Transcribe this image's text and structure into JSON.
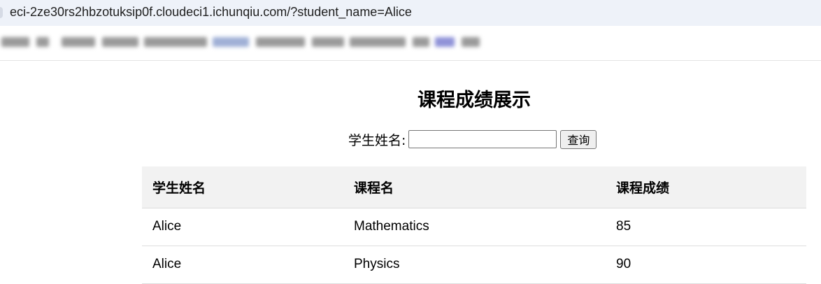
{
  "browser": {
    "url": "eci-2ze30rs2hbzotuksip0f.cloudeci1.ichunqiu.com/?student_name=Alice"
  },
  "page": {
    "title": "课程成绩展示",
    "search": {
      "label": "学生姓名:",
      "value": "",
      "placeholder": "",
      "button_label": "查询"
    },
    "table": {
      "headers": [
        "学生姓名",
        "课程名",
        "课程成绩"
      ],
      "rows": [
        [
          "Alice",
          "Mathematics",
          "85"
        ],
        [
          "Alice",
          "Physics",
          "90"
        ]
      ]
    }
  }
}
